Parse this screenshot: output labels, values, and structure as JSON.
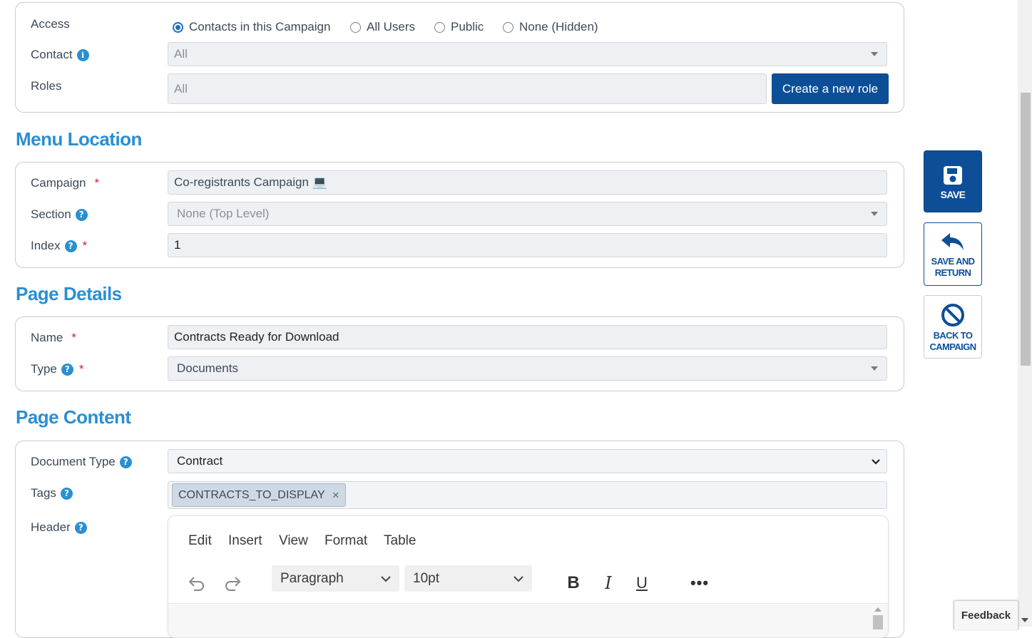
{
  "access": {
    "label": "Access",
    "options": [
      "Contacts in this Campaign",
      "All Users",
      "Public",
      "None (Hidden)"
    ],
    "selected": "Contacts in this Campaign"
  },
  "contact": {
    "label": "Contact",
    "value": "All"
  },
  "roles": {
    "label": "Roles",
    "value": "All",
    "create_button": "Create a new role"
  },
  "menu_location": {
    "title": "Menu Location",
    "campaign_label": "Campaign",
    "campaign_value": "Co-registrants Campaign 💻",
    "section_label": "Section",
    "section_value": "None (Top Level)",
    "index_label": "Index",
    "index_value": "1"
  },
  "page_details": {
    "title": "Page Details",
    "name_label": "Name",
    "name_value": "Contracts Ready for Download",
    "type_label": "Type",
    "type_value": "Documents"
  },
  "page_content": {
    "title": "Page Content",
    "doc_type_label": "Document Type",
    "doc_type_value": "Contract",
    "tags_label": "Tags",
    "tags": [
      "CONTRACTS_TO_DISPLAY"
    ],
    "header_label": "Header"
  },
  "editor": {
    "menu": [
      "Edit",
      "Insert",
      "View",
      "Format",
      "Table"
    ],
    "block_format": "Paragraph",
    "font_size": "10pt"
  },
  "side_actions": {
    "save": "SAVE",
    "save_return_1": "SAVE AND",
    "save_return_2": "RETURN",
    "back_1": "BACK TO",
    "back_2": "CAMPAIGN"
  },
  "feedback": "Feedback",
  "colors": {
    "accent": "#2a8fd2",
    "primary_button": "#0d4f97",
    "required": "#c8202f"
  }
}
